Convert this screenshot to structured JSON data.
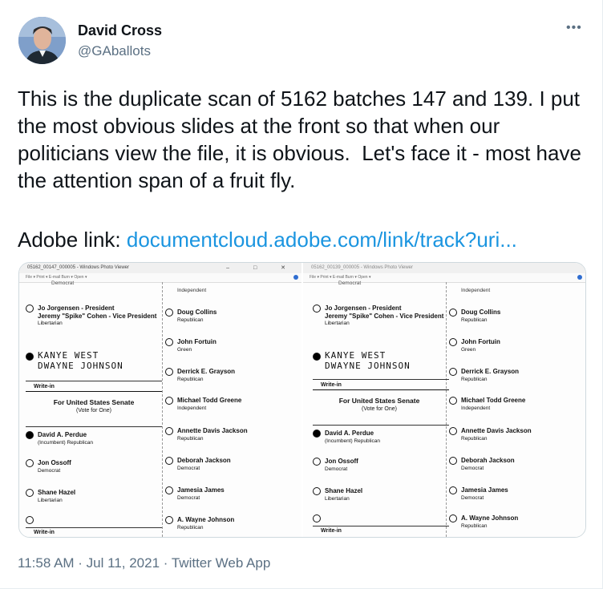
{
  "author": {
    "name": "David Cross",
    "handle": "@GAballots"
  },
  "more_label": "•••",
  "tweet_text": "This is the duplicate scan of 5162 batches 147 and 139. I put the most obvious slides at the front so that when our politicians view the file, it is obvious.  Let's face it - most have the attention span of a fruit fly.",
  "adobe_label": "Adobe link: ",
  "adobe_link": "documentcloud.adobe.com/link/track?uri...",
  "media": {
    "left_title": "05162_00147_000005 - Windows Photo Viewer",
    "right_title": "05162_00139_000005 - Windows Photo Viewer",
    "menu": "File ▾   Print ▾   E-mail   Burn ▾   Open ▾",
    "window_controls": "–  □  ✕",
    "ballot": {
      "top_left": "Democrat",
      "top_right": "Independent",
      "jorgensen": "Jo Jorgensen - President",
      "cohen": "Jeremy \"Spike\" Cohen - Vice President",
      "libertarian": "Libertarian",
      "writein_line1": "KANYE WEST",
      "writein_line2": "DWAYNE JOHNSON",
      "write_in": "Write-in",
      "senate_title": "For United States Senate",
      "senate_sub": "(Vote for One)",
      "perdue": "David A. Perdue",
      "perdue_sub": "(Incumbent) Republican",
      "ossoff": "Jon Ossoff",
      "democrat": "Democrat",
      "hazel": "Shane Hazel",
      "hazel_party": "Libertarian",
      "write_in_bottom": "Write-in",
      "collins": "Doug Collins",
      "republican": "Republican",
      "fortuin": "John Fortuin",
      "green": "Green",
      "grayson": "Derrick E. Grayson",
      "grayson_party": "Republican",
      "greene": "Michael Todd Greene",
      "independent": "Independent",
      "jackson_a": "Annette Davis Jackson",
      "jackson_a_party": "Republican",
      "jackson_d": "Deborah Jackson",
      "jackson_d_party": "Democrat",
      "james": "Jamesia James",
      "james_party": "Democrat",
      "johnson": "A. Wayne Johnson",
      "johnson_party": "Republican"
    }
  },
  "timestamp": "11:58 AM · Jul 11, 2021 · Twitter Web App"
}
